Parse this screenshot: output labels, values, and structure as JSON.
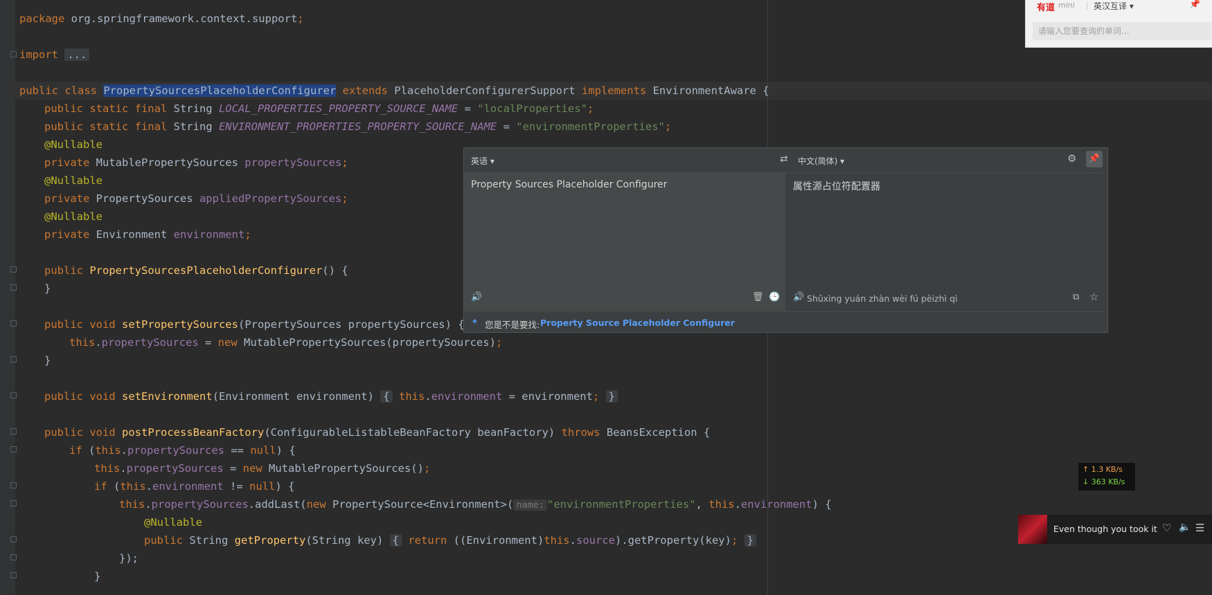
{
  "editor": {
    "lines": {
      "l1_kw": "package",
      "l1_txt": " org.springframework.context.support",
      "l1_semi": ";",
      "l2_kw": "import",
      "l2_fold": "...",
      "l3_kw1": "public class",
      "l3_sel": "PropertySourcesPlaceholderConfigurer",
      "l3_kw2": "extends",
      "l3_t1": " PlaceholderConfigurerSupport ",
      "l3_kw3": "implements",
      "l3_t2": " EnvironmentAware {",
      "l4_kw": "public static final",
      "l4_t": " String ",
      "l4_c": "LOCAL_PROPERTIES_PROPERTY_SOURCE_NAME",
      "l4_eq": " = ",
      "l4_s": "\"localProperties\"",
      "l4_semi": ";",
      "l5_kw": "public static final",
      "l5_t": " String ",
      "l5_c": "ENVIRONMENT_PROPERTIES_PROPERTY_SOURCE_NAME",
      "l5_eq": " = ",
      "l5_s": "\"environmentProperties\"",
      "l5_semi": ";",
      "ann": "@Nullable",
      "l7_kw": "private",
      "l7_t": " MutablePropertySources ",
      "l7_f": "propertySources",
      "l9_kw": "private",
      "l9_t": " PropertySources ",
      "l9_f": "appliedPropertySources",
      "l11_kw": "private",
      "l11_t": " Environment ",
      "l11_f": "environment",
      "semi": ";",
      "l12_kw": "public",
      "l12_fn": "PropertySourcesPlaceholderConfigurer",
      "l12_t": "() {",
      "close": "}",
      "l14_kw": "public void",
      "l14_fn": "setPropertySources",
      "l14_t": "(PropertySources propertySources) {",
      "this": "this",
      "l15_dot": ".",
      "l15_f": "propertySources",
      "l15_eq": " = ",
      "new": "new",
      "l15_t": " MutablePropertySources(propertySources)",
      "l17_kw": "public void",
      "l17_fn": "setEnvironment",
      "l17_t": "(Environment environment) ",
      "l17_open": "{",
      "l17_f": "environment",
      "l17_eq": " = environment",
      "l19_kw": "public void",
      "l19_fn": "postProcessBeanFactory",
      "l19_t": "(ConfigurableListableBeanFactory beanFactory) ",
      "throws": "throws",
      "l19_t2": " BeansException {",
      "if": "if",
      "l20_t1": " (",
      "l20_t2": " == ",
      "null": "null",
      "l20_t3": ") {",
      "l21_t": " MutablePropertySources()",
      "l22_f": "environment",
      "l22_t2": " != ",
      "l23_t1": ".addLast(",
      "l23_t2": " PropertySource<Environment>(",
      "l23_hint": "name:",
      "l23_s": "\"environmentProperties\"",
      "l23_comma": ", ",
      "l23_t3": ") {",
      "l25_kw": "public",
      "l25_t1": " String ",
      "l25_fn": "getProperty",
      "l25_t2": "(String key) ",
      "return": "return",
      "l25_t3": " ((Environment)",
      "l25_f": "source",
      "l25_t4": ").getProperty(key)",
      "l26": "});"
    }
  },
  "youdao_mini": {
    "logo": "有道",
    "mini": "mini",
    "language_mode": "英汉互译 ▾",
    "pin_icon": "pin-icon",
    "search_placeholder": "请输入您要查询的单词..."
  },
  "translate_popup": {
    "source_lang": "英语 ▾",
    "target_lang": "中文(简体) ▾",
    "source_text": "Property Sources Placeholder Configurer",
    "translated_text": "属性源占位符配置器",
    "pinyin": "Shǔxìng yuán zhàn wèi fú pèizhì qì",
    "did_you_mean_label": "您是不是要找:",
    "did_you_mean_value": "Property Source Placeholder Configurer"
  },
  "network": {
    "upload": "↑ 1.3 KB/s",
    "download": "↓ 363 KB/s"
  },
  "music": {
    "song_title": "Even though you took it"
  },
  "colors": {
    "editor_bg": "#2b2b2b",
    "keyword": "#cc7832",
    "field": "#9876aa",
    "string": "#6a8759",
    "annotation": "#bbb529",
    "method": "#ffc66d",
    "link": "#589df6"
  }
}
